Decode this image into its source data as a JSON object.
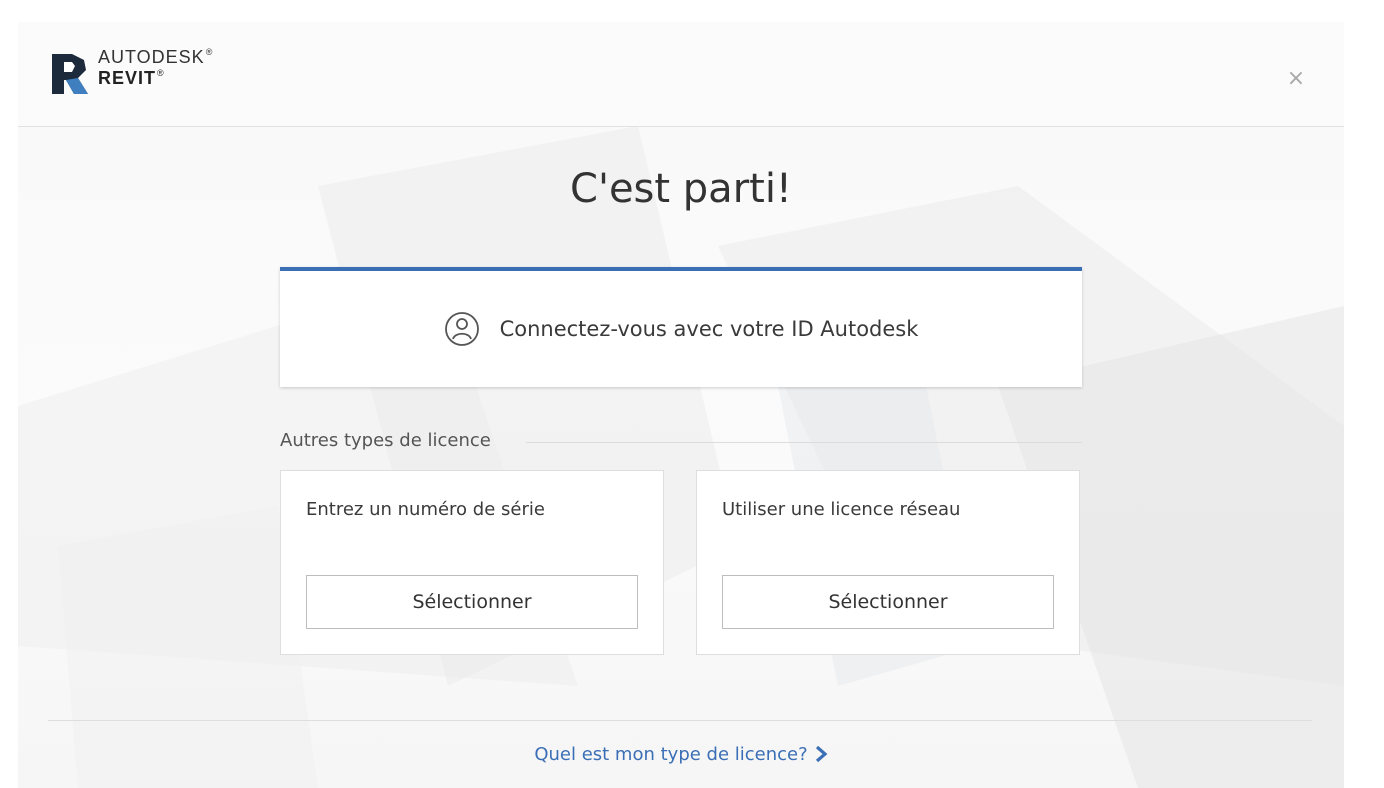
{
  "header": {
    "brand_top": "AUTODESK",
    "brand_bottom": "REVIT",
    "trademark": "®",
    "close_glyph": "×"
  },
  "main": {
    "title": "C'est parti!",
    "signin": {
      "label": "Connectez-vous avec votre ID Autodesk",
      "icon": "user-circle-icon"
    },
    "other_licenses": {
      "section_label": "Autres types de licence",
      "options": [
        {
          "label": "Entrez un numéro de série",
          "button": "Sélectionner"
        },
        {
          "label": "Utiliser une licence réseau",
          "button": "Sélectionner"
        }
      ]
    }
  },
  "footer": {
    "link": "Quel est mon type de licence?",
    "link_icon": "chevron-right-icon"
  },
  "colors": {
    "accent": "#3b6fb5",
    "logo_dark": "#1d2a3c",
    "logo_blue": "#3f7fc0"
  }
}
